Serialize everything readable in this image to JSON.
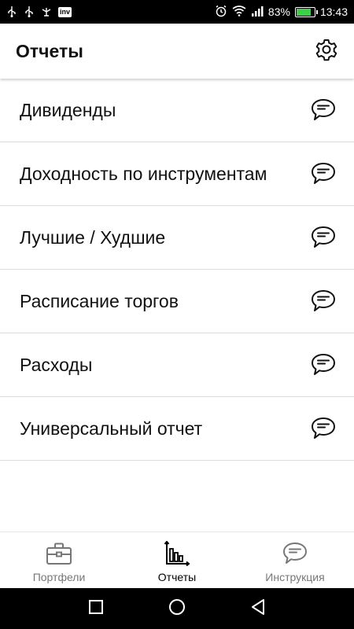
{
  "status_bar": {
    "notif_badge": "inv",
    "battery_percent": "83%",
    "battery_level": 0.83,
    "time": "13:43"
  },
  "app_bar": {
    "title": "Отчеты",
    "settings_icon": "gear-icon"
  },
  "reports": [
    {
      "label": "Дивиденды",
      "icon": "chat-bubble-icon"
    },
    {
      "label": "Доходность по инструментам",
      "icon": "chat-bubble-icon"
    },
    {
      "label": "Лучшие / Худшие",
      "icon": "chat-bubble-icon"
    },
    {
      "label": "Расписание торгов",
      "icon": "chat-bubble-icon"
    },
    {
      "label": "Расходы",
      "icon": "chat-bubble-icon"
    },
    {
      "label": "Универсальный отчет",
      "icon": "chat-bubble-icon"
    }
  ],
  "bottom_nav": {
    "tabs": [
      {
        "label": "Портфели",
        "icon": "briefcase-icon",
        "active": false
      },
      {
        "label": "Отчеты",
        "icon": "bar-chart-icon",
        "active": true
      },
      {
        "label": "Инструкция",
        "icon": "chat-bubble-icon",
        "active": false
      }
    ]
  },
  "colors": {
    "battery_fill": "#3ecf4a",
    "active_tab_text": "#000000",
    "inactive_tab_text": "#777777"
  }
}
